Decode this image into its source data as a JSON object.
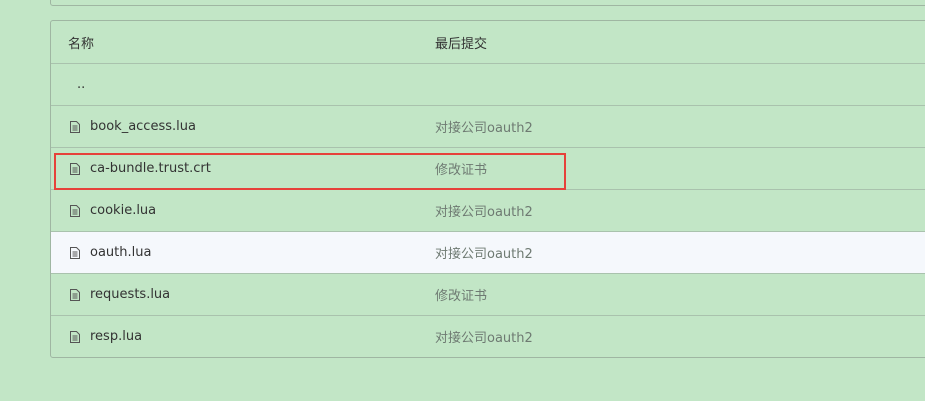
{
  "table": {
    "header": {
      "name": "名称",
      "last_commit": "最后提交"
    },
    "parent_dir": "..",
    "rows": [
      {
        "name": "book_access.lua",
        "commit": "对接公司oauth2",
        "icon": "file-icon"
      },
      {
        "name": "ca-bundle.trust.crt",
        "commit": "修改证书",
        "icon": "file-icon"
      },
      {
        "name": "cookie.lua",
        "commit": "对接公司oauth2",
        "icon": "file-icon"
      },
      {
        "name": "oauth.lua",
        "commit": "对接公司oauth2",
        "icon": "file-icon"
      },
      {
        "name": "requests.lua",
        "commit": "修改证书",
        "icon": "file-icon"
      },
      {
        "name": "resp.lua",
        "commit": "对接公司oauth2",
        "icon": "file-icon"
      }
    ]
  },
  "colors": {
    "background": "#c2e6c6",
    "hover_row": "#f5f8fc",
    "annotation": "#e6413a"
  }
}
